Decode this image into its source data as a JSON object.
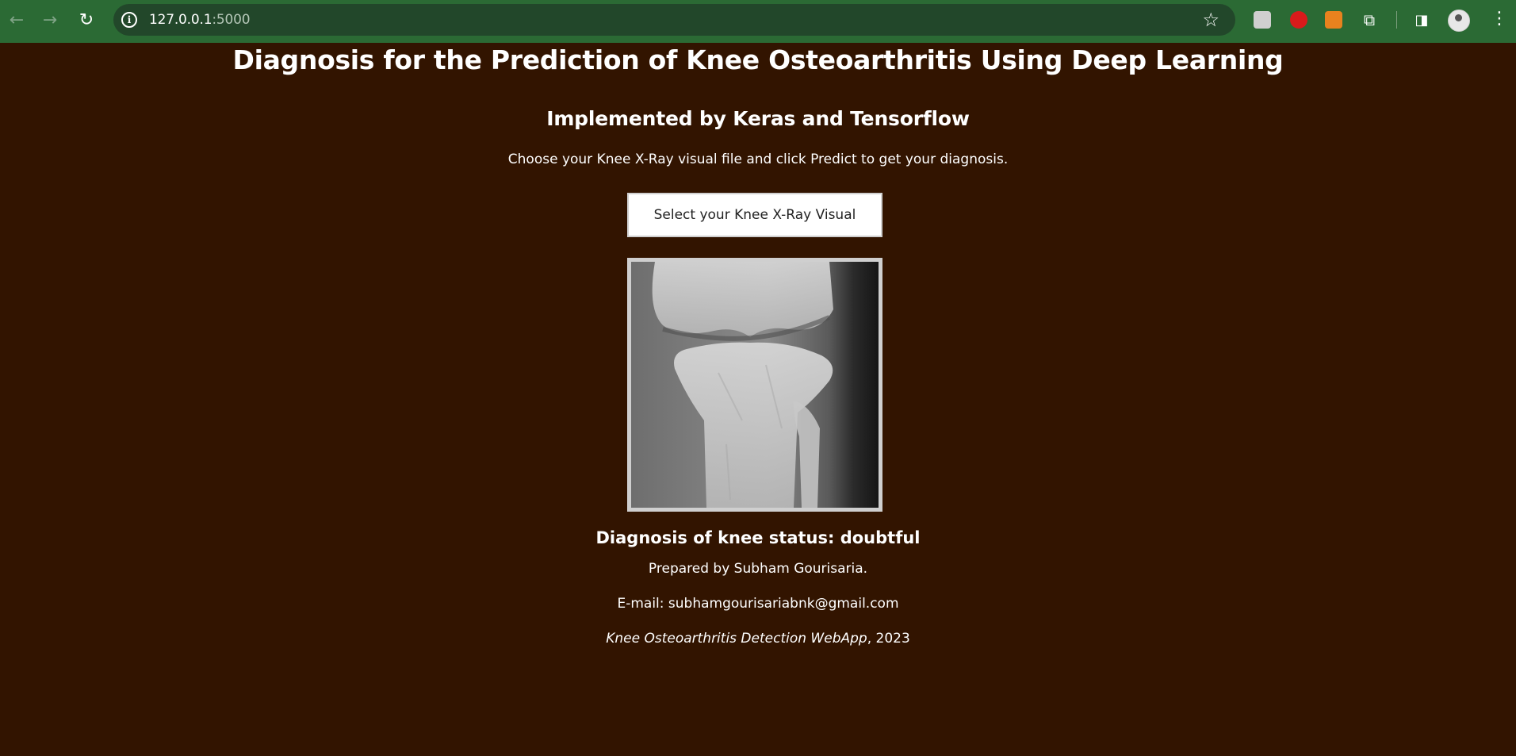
{
  "browser": {
    "url_host": "127.0.0.1",
    "url_port": ":5000",
    "icons": [
      "back-icon",
      "forward-icon",
      "reload-icon",
      "site-info-icon",
      "bookmark-star-icon",
      "extension-icon",
      "puzzle-icon",
      "side-panel-icon",
      "profile-avatar",
      "menu-icon"
    ]
  },
  "page": {
    "title": "Diagnosis for the Prediction of Knee Osteoarthritis Using Deep Learning",
    "subtitle": "Implemented by Keras and Tensorflow",
    "instructions": "Choose your Knee X-Ray visual file and click Predict to get your diagnosis.",
    "select_button": "Select your Knee X-Ray Visual",
    "result": "Diagnosis of knee status: doubtful",
    "prepared_by": "Prepared by Subham Gourisaria.",
    "email": "E-mail: subhamgourisariabnk@gmail.com",
    "footer_app": "Knee Osteoarthritis Detection WebApp",
    "footer_year": ", 2023"
  },
  "colors": {
    "toolbar": "#2b6a34",
    "page_background": "#321400",
    "text": "#ffffff"
  }
}
